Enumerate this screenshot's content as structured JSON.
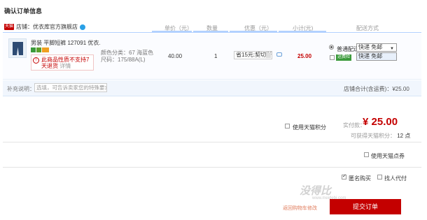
{
  "page": {
    "title": "确认订单信息"
  },
  "shop": {
    "badge": "天猫",
    "label": "店铺：优衣库官方旗舰店"
  },
  "columns": {
    "price": "单价（元）",
    "quantity": "数量",
    "promo": "优惠（元）",
    "subtotal": "小计(元)",
    "shipping": "配送方式"
  },
  "item": {
    "name": "男装 平脚短裤 127091 优衣...",
    "notice_text": "此商品性质不支持7天退货",
    "notice_detail": "详情",
    "color": "颜色分类：67 海蓝色",
    "size": "尺码：175/88A(L)",
    "price": "40.00",
    "quantity": "1",
    "promo": "省15元:契切斯",
    "subtotal": "25.00"
  },
  "shipping": {
    "label": "普通配送",
    "selected": "快递 免邮",
    "dropdown_option": "快递 免邮",
    "insure_tag": "运费险"
  },
  "remark": {
    "label": "补充说明：",
    "placeholder": "选填，可告诉卖家您的特殊要求"
  },
  "shop_total": "店铺合计(含运费)：¥25.00",
  "tmall_points": {
    "label": "使用天猫积分"
  },
  "paid": {
    "label": "实付款：",
    "value": "¥ 25.00"
  },
  "points_gain": {
    "label": "可获得天猫积分：",
    "value": "12 点"
  },
  "tmall_coupon": {
    "label": "使用天猫点券"
  },
  "anonymous": {
    "label": "匿名购买",
    "checked": true
  },
  "proxy_pay": {
    "label": "找人代付"
  },
  "back_link": "返回购物车修改",
  "submit": "提交订单",
  "watermark": {
    "main": "没得比",
    "sub": "www.meidebi.com"
  }
}
